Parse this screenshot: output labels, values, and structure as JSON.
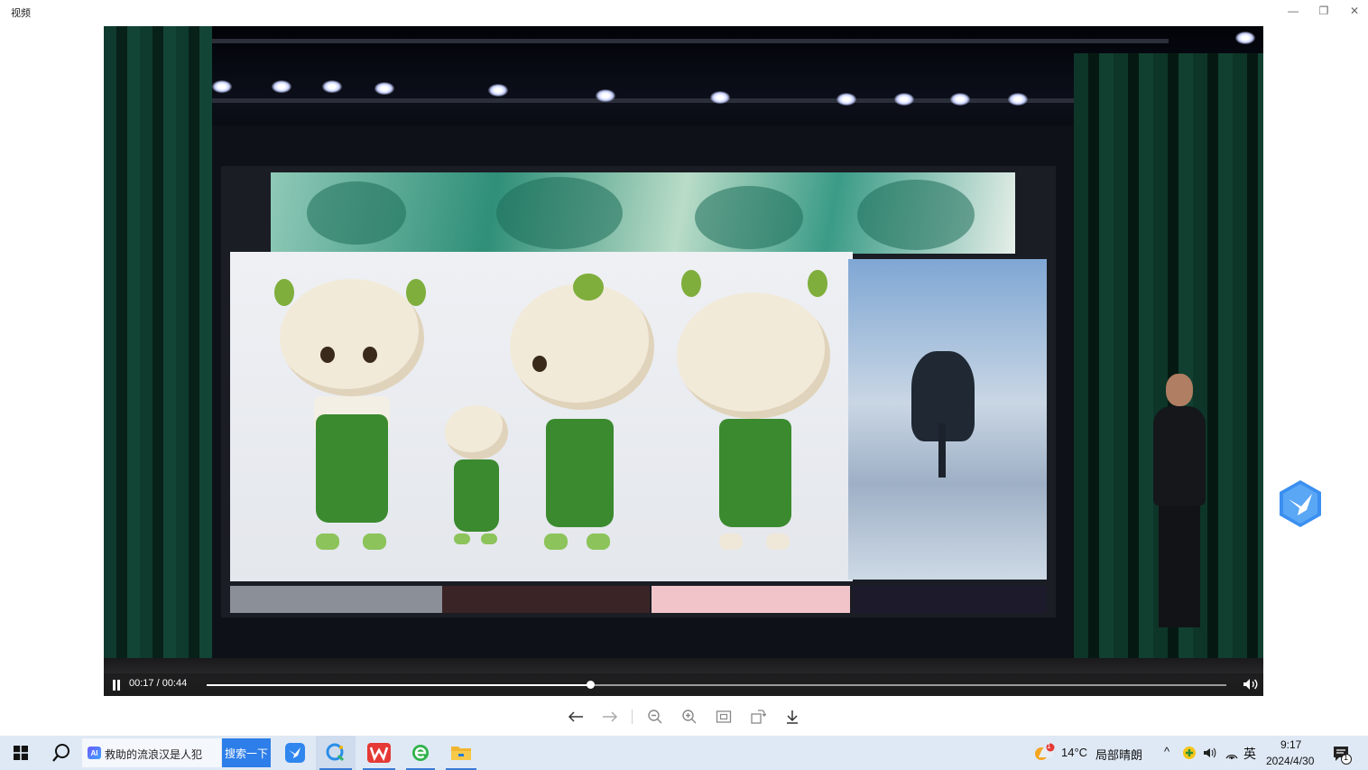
{
  "window": {
    "title": "视频",
    "minimize_glyph": "—",
    "restore_glyph": "❐",
    "close_glyph": "✕"
  },
  "player": {
    "current_time": "00:17",
    "total_time": "00:44",
    "time_display": "00:17 / 00:44",
    "progress_fraction": 0.376,
    "state": "playing",
    "pause_icon": "pause-icon",
    "volume_icon": "volume-icon"
  },
  "toolbar": {
    "buttons": [
      {
        "name": "prev-button",
        "icon": "arrow-left-icon",
        "glyph": "←"
      },
      {
        "name": "next-button",
        "icon": "arrow-right-icon",
        "glyph": "→"
      },
      {
        "name": "zoom-out-button",
        "icon": "zoom-out-icon"
      },
      {
        "name": "zoom-in-button",
        "icon": "zoom-in-icon"
      },
      {
        "name": "fit-button",
        "icon": "fit-screen-icon"
      },
      {
        "name": "rotate-button",
        "icon": "rotate-icon"
      },
      {
        "name": "download-button",
        "icon": "download-icon",
        "glyph": "↓"
      }
    ]
  },
  "floating_widget": {
    "icon": "bird-icon",
    "color": "#3a8ff0"
  },
  "taskbar": {
    "start_icon": "windows-icon",
    "search_icon": "search-icon",
    "search_text": "救助的流浪汉是人犯",
    "ai_badge": "AI",
    "search_button": "搜索一下",
    "apps": [
      {
        "name": "taskbar-app-bird",
        "icon": "bird-app-icon"
      },
      {
        "name": "taskbar-app-browser",
        "icon": "browser-icon"
      },
      {
        "name": "taskbar-app-wps",
        "icon": "wps-icon"
      },
      {
        "name": "taskbar-app-ie",
        "icon": "ie-icon"
      },
      {
        "name": "taskbar-app-folder",
        "icon": "folder-icon"
      }
    ],
    "weather": {
      "temp": "14°C",
      "desc": "局部晴朗",
      "badge": "1"
    },
    "tray": {
      "chevron": "^",
      "ime": "英"
    },
    "clock": {
      "time": "9:17",
      "date": "2024/4/30"
    },
    "notification_count": "1"
  }
}
